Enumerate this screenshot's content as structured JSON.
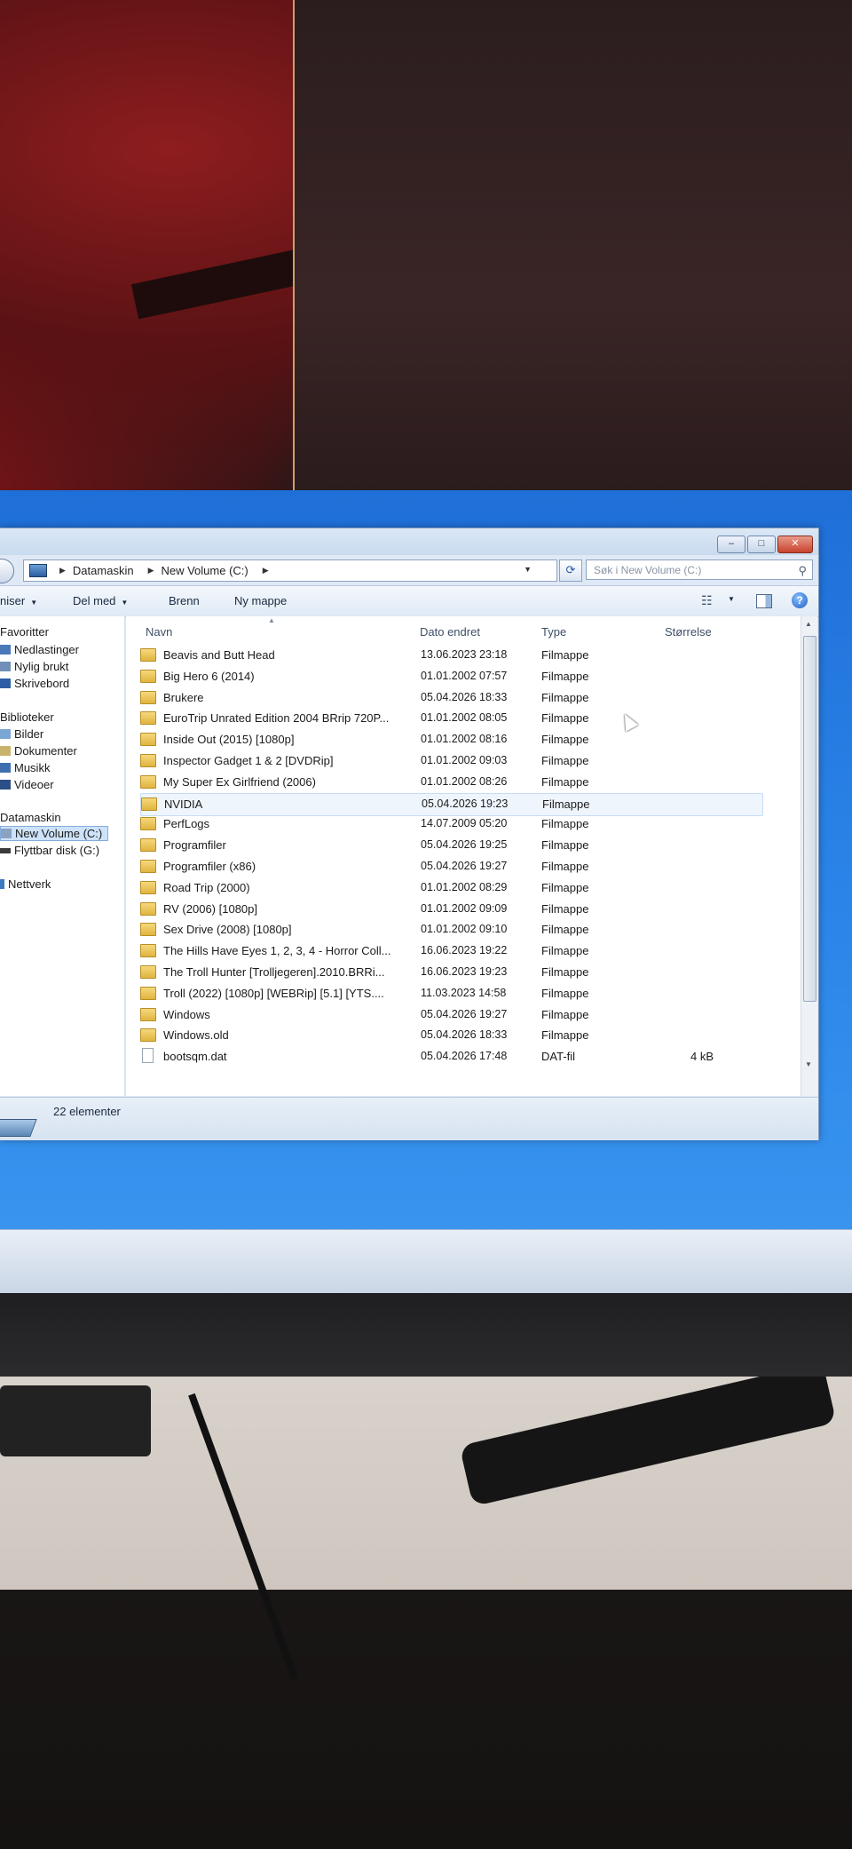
{
  "address": {
    "crumbs": [
      "Datamaskin",
      "New Volume (C:)"
    ],
    "search_placeholder": "Søk i New Volume (C:)"
  },
  "toolbar": {
    "organize_label": "niser",
    "share_label": "Del med",
    "burn_label": "Brenn",
    "new_folder_label": "Ny mappe"
  },
  "nav": {
    "favorites_header": "Favoritter",
    "favorites": [
      "Nedlastinger",
      "Nylig brukt",
      "Skrivebord"
    ],
    "libraries_header": "Biblioteker",
    "libraries": [
      "Bilder",
      "Dokumenter",
      "Musikk",
      "Videoer"
    ],
    "computer_header": "Datamaskin",
    "drives": [
      "New Volume (C:)",
      "Flyttbar disk (G:)"
    ],
    "network_header": "Nettverk"
  },
  "columns": {
    "name": "Navn",
    "date": "Dato endret",
    "type": "Type",
    "size": "Størrelse"
  },
  "files": [
    {
      "name": "Beavis and Butt Head",
      "date": "13.06.2023 23:18",
      "type": "Filmappe",
      "size": ""
    },
    {
      "name": "Big Hero 6 (2014)",
      "date": "01.01.2002 07:57",
      "type": "Filmappe",
      "size": ""
    },
    {
      "name": "Brukere",
      "date": "05.04.2026 18:33",
      "type": "Filmappe",
      "size": ""
    },
    {
      "name": "EuroTrip Unrated Edition 2004 BRrip 720P...",
      "date": "01.01.2002 08:05",
      "type": "Filmappe",
      "size": ""
    },
    {
      "name": "Inside Out (2015) [1080p]",
      "date": "01.01.2002 08:16",
      "type": "Filmappe",
      "size": ""
    },
    {
      "name": "Inspector Gadget 1 & 2 [DVDRip]",
      "date": "01.01.2002 09:03",
      "type": "Filmappe",
      "size": ""
    },
    {
      "name": "My Super Ex Girlfriend (2006)",
      "date": "01.01.2002 08:26",
      "type": "Filmappe",
      "size": ""
    },
    {
      "name": "NVIDIA",
      "date": "05.04.2026 19:23",
      "type": "Filmappe",
      "size": ""
    },
    {
      "name": "PerfLogs",
      "date": "14.07.2009 05:20",
      "type": "Filmappe",
      "size": ""
    },
    {
      "name": "Programfiler",
      "date": "05.04.2026 19:25",
      "type": "Filmappe",
      "size": ""
    },
    {
      "name": "Programfiler (x86)",
      "date": "05.04.2026 19:27",
      "type": "Filmappe",
      "size": ""
    },
    {
      "name": "Road Trip (2000)",
      "date": "01.01.2002 08:29",
      "type": "Filmappe",
      "size": ""
    },
    {
      "name": "RV (2006) [1080p]",
      "date": "01.01.2002 09:09",
      "type": "Filmappe",
      "size": ""
    },
    {
      "name": "Sex Drive (2008) [1080p]",
      "date": "01.01.2002 09:10",
      "type": "Filmappe",
      "size": ""
    },
    {
      "name": "The Hills Have Eyes 1, 2, 3, 4 - Horror Coll...",
      "date": "16.06.2023 19:22",
      "type": "Filmappe",
      "size": ""
    },
    {
      "name": "The Troll Hunter [Trolljegeren].2010.BRRi...",
      "date": "16.06.2023 19:23",
      "type": "Filmappe",
      "size": ""
    },
    {
      "name": "Troll (2022) [1080p] [WEBRip] [5.1] [YTS....",
      "date": "11.03.2023 14:58",
      "type": "Filmappe",
      "size": ""
    },
    {
      "name": "Windows",
      "date": "05.04.2026 19:27",
      "type": "Filmappe",
      "size": ""
    },
    {
      "name": "Windows.old",
      "date": "05.04.2026 18:33",
      "type": "Filmappe",
      "size": ""
    },
    {
      "name": "bootsqm.dat",
      "date": "05.04.2026 17:48",
      "type": "DAT-fil",
      "size": "4 kB"
    }
  ],
  "status": {
    "count": "22 elementer"
  },
  "colors": {
    "folder": "#e0b43f",
    "selection": "#cde3f9",
    "desktop": "#2c86ea"
  }
}
